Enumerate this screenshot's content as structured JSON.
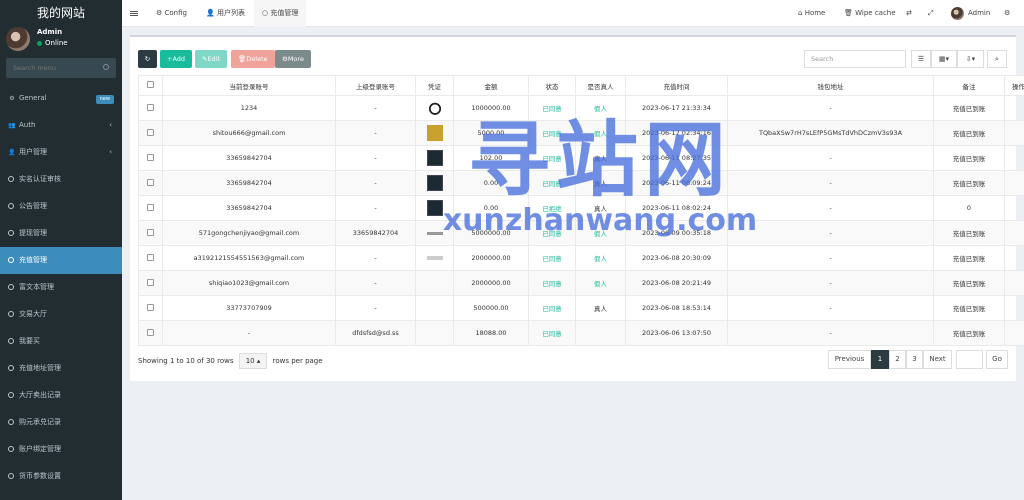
{
  "sidebar": {
    "brand": "我的网站",
    "user": {
      "name": "Admin",
      "status": "Online"
    },
    "search_placeholder": "Search menu",
    "items": [
      {
        "label": "General",
        "icon": "gears-icon",
        "badge": "new"
      },
      {
        "label": "Auth",
        "icon": "users-icon",
        "chevron": "‹"
      },
      {
        "label": "用户管理",
        "icon": "user-icon",
        "chevron": "‹"
      },
      {
        "label": "实名认证审核",
        "icon": "circle-icon"
      },
      {
        "label": "公告管理",
        "icon": "circle-icon"
      },
      {
        "label": "提现管理",
        "icon": "circle-icon"
      },
      {
        "label": "充值管理",
        "icon": "circle-icon",
        "active": true
      },
      {
        "label": "富文本管理",
        "icon": "circle-icon"
      },
      {
        "label": "交易大厅",
        "icon": "circle-icon"
      },
      {
        "label": "我要买",
        "icon": "circle-icon"
      },
      {
        "label": "充值地址管理",
        "icon": "circle-icon"
      },
      {
        "label": "大厅卖出记录",
        "icon": "circle-icon"
      },
      {
        "label": "购元承兑记录",
        "icon": "circle-icon"
      },
      {
        "label": "账户绑定管理",
        "icon": "circle-icon"
      },
      {
        "label": "货币参数设置",
        "icon": "circle-icon"
      }
    ]
  },
  "topbar": {
    "tabs": [
      "Config",
      "用户列表",
      "充值管理"
    ],
    "home": "Home",
    "wipe_cache": "Wipe cache",
    "admin": "Admin"
  },
  "toolbar": {
    "add": "Add",
    "edit": "Edit",
    "delete": "Delete",
    "more": "More",
    "search_placeholder": "Search"
  },
  "table": {
    "headers": [
      "当前登录账号",
      "上级登录账号",
      "凭证",
      "金额",
      "状态",
      "是否真人",
      "充值时间",
      "钱包地址",
      "备注",
      "操作"
    ],
    "rows": [
      {
        "account": "1234",
        "parent": "-",
        "thumb": "panda",
        "amount": "1000000.00",
        "status": "已同意",
        "real": "假人",
        "real_type": "fake",
        "time": "2023-06-17 21:33:34",
        "wallet": "-",
        "note": "充值已到账"
      },
      {
        "account": "shitou666@gmail.com",
        "parent": "-",
        "thumb": "gold",
        "amount": "5000.00",
        "status": "已同意",
        "real": "假人",
        "real_type": "fake",
        "time": "2023-06-17 02:34:16",
        "wallet": "TQbaXSw7rH7sLEfP5GMsTdVhDCzmV3s93A",
        "note": "充值已到账"
      },
      {
        "account": "33659842704",
        "parent": "-",
        "thumb": "dark",
        "amount": "102.00",
        "status": "已同意",
        "real": "真人",
        "real_type": "real",
        "time": "2023-06-11 08:27:35",
        "wallet": "-",
        "note": "充值已到账"
      },
      {
        "account": "33659842704",
        "parent": "-",
        "thumb": "dark",
        "amount": "0.00",
        "status": "已同意",
        "real": "真人",
        "real_type": "real",
        "time": "2023-06-11 08:09:24",
        "wallet": "-",
        "note": "充值已到账"
      },
      {
        "account": "33659842704",
        "parent": "-",
        "thumb": "dark",
        "amount": "0.00",
        "status": "已拒绝",
        "real": "真人",
        "real_type": "real",
        "time": "2023-06-11 08:02:24",
        "wallet": "-",
        "note": "0"
      },
      {
        "account": "571gongchenjiyao@gmail.com",
        "parent": "33659842704",
        "thumb": "thin",
        "amount": "5000000.00",
        "status": "已同意",
        "real": "假人",
        "real_type": "fake",
        "time": "2023-06-09 00:35:18",
        "wallet": "-",
        "note": "充值已到账"
      },
      {
        "account": "a3192121554551563@gmail.com",
        "parent": "-",
        "thumb": "light",
        "amount": "2000000.00",
        "status": "已同意",
        "real": "假人",
        "real_type": "fake",
        "time": "2023-06-08 20:30:09",
        "wallet": "-",
        "note": "充值已到账"
      },
      {
        "account": "shiqiao1023@gmail.com",
        "parent": "-",
        "thumb": "",
        "amount": "2000000.00",
        "status": "已同意",
        "real": "假人",
        "real_type": "fake",
        "time": "2023-06-08 20:21:49",
        "wallet": "-",
        "note": "充值已到账"
      },
      {
        "account": "33773707909",
        "parent": "-",
        "thumb": "",
        "amount": "500000.00",
        "status": "已同意",
        "real": "真人",
        "real_type": "real",
        "time": "2023-06-08 18:53:14",
        "wallet": "-",
        "note": "充值已到账"
      },
      {
        "account": "-",
        "parent": "dfdsfsd@sd.ss",
        "thumb": "",
        "amount": "18088.00",
        "status": "已同意",
        "real": "",
        "real_type": "real",
        "time": "2023-06-06 13:07:50",
        "wallet": "-",
        "note": "充值已到账"
      }
    ]
  },
  "footer": {
    "showing": "Showing 1 to 10 of 30 rows",
    "page_size": "10 ▴",
    "rows_per_page": "rows per page",
    "previous": "Previous",
    "pages": [
      "1",
      "2",
      "3"
    ],
    "next": "Next",
    "go": "Go"
  },
  "watermark": {
    "big": "寻站网",
    "small": "xunzhanwang.com"
  },
  "colors": {
    "sidebar_bg": "#222d32",
    "active": "#3c8dbc",
    "add": "#18bc9c",
    "status_ok": "#18bc9c"
  }
}
